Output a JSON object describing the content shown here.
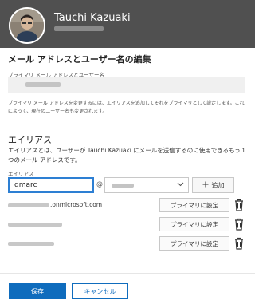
{
  "header": {
    "user_name": "Tauchi Kazuaki"
  },
  "page": {
    "title": "メール アドレスとユーザー名の編集"
  },
  "primary": {
    "label": "プライマリ メール アドレスとユーザー名",
    "help_text": "プライマリ メール アドレスを変更するには、エイリアスを追加してそれをプライマリとして設定します。これによって、現在のユーザー名も変更されます。"
  },
  "aliases": {
    "section_title": "エイリアス",
    "description": "エイリアスとは、ユーザーが Tauchi Kazuaki にメールを送信するのに使用できるもう１つのメール アドレスです。",
    "input_label": "エイリアス",
    "input_value": "dmarc",
    "at_sign": "@",
    "add_label": "追加",
    "set_primary_label": "プライマリに設定",
    "list": [
      {
        "suffix": ".onmicrosoft.com"
      },
      {
        "suffix": ""
      },
      {
        "suffix": ""
      }
    ]
  },
  "footer": {
    "save_label": "保存",
    "cancel_label": "キャンセル"
  },
  "colors": {
    "header_bg": "#505050",
    "accent": "#0f6cbd",
    "focus_border": "#2d7fd3"
  },
  "icons": {
    "add": "plus-icon",
    "dropdown": "chevron-down-icon",
    "delete": "trash-icon"
  }
}
